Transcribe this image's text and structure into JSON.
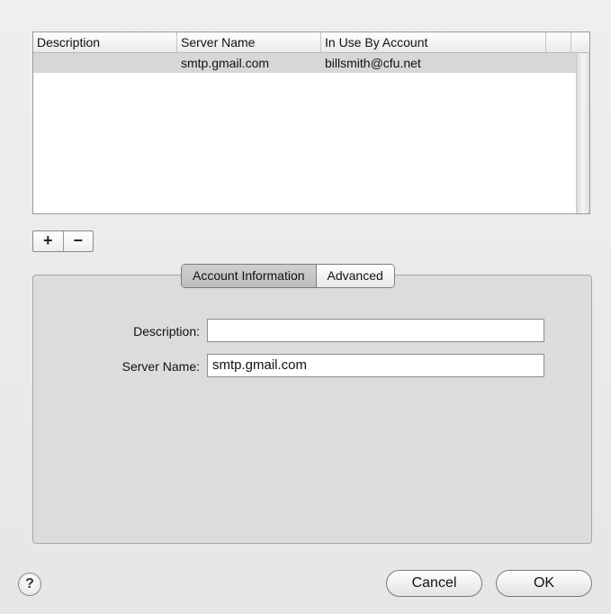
{
  "table": {
    "columns": [
      "Description",
      "Server Name",
      "In Use By Account"
    ],
    "rows": [
      {
        "description": "",
        "server_name": "smtp.gmail.com",
        "account": "billsmith@cfu.net"
      }
    ]
  },
  "controls": {
    "add_label": "+",
    "remove_label": "−"
  },
  "tabs": [
    {
      "label": "Account Information",
      "active": true
    },
    {
      "label": "Advanced",
      "active": false
    }
  ],
  "form": {
    "description_label": "Description:",
    "description_value": "",
    "server_name_label": "Server Name:",
    "server_name_value": "smtp.gmail.com"
  },
  "footer": {
    "help_label": "?",
    "cancel_label": "Cancel",
    "ok_label": "OK"
  }
}
